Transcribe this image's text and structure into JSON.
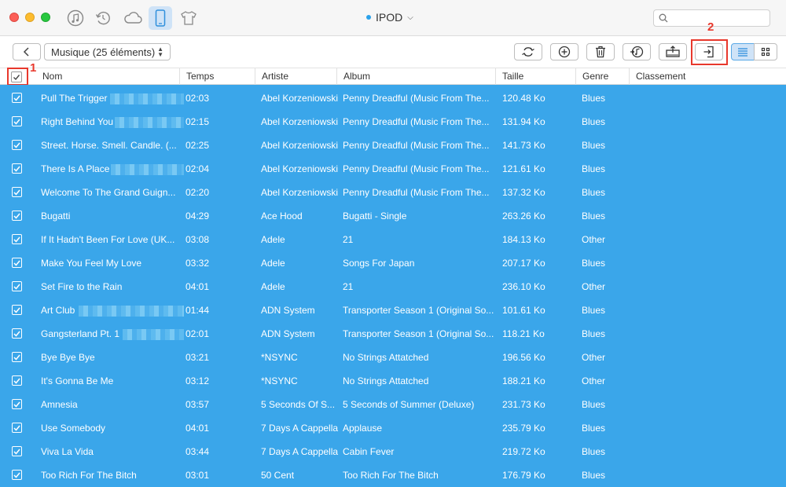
{
  "window": {
    "device_name": "IPOD",
    "search_placeholder": ""
  },
  "titlebar_icons": [
    "music-note-icon",
    "restore-icon",
    "cloud-icon",
    "device-icon",
    "tshirt-icon"
  ],
  "toolbar": {
    "category_label": "Musique (25 éléments)",
    "tools": [
      "refresh-icon",
      "add-icon",
      "trash-icon",
      "to-itunes-icon",
      "to-computer-icon",
      "to-device-icon"
    ],
    "annotation_1": "1",
    "annotation_2": "2"
  },
  "colors": {
    "selection": "#3aa6ea",
    "annotation": "#e8382c"
  },
  "columns": [
    "Nom",
    "Temps",
    "Artiste",
    "Album",
    "Taille",
    "Genre",
    "Classement"
  ],
  "rows": [
    {
      "name": "Pull The Trigger",
      "time": "02:03",
      "artist": "Abel Korzeniowski",
      "album": "Penny Dreadful (Music From The...",
      "size": "120.48 Ko",
      "genre": "Blues",
      "blurred": true
    },
    {
      "name": "Right Behind You",
      "time": "02:15",
      "artist": "Abel Korzeniowski",
      "album": "Penny Dreadful (Music From The...",
      "size": "131.94 Ko",
      "genre": "Blues",
      "blurred": true
    },
    {
      "name": "Street. Horse. Smell. Candle. (...",
      "time": "02:25",
      "artist": "Abel Korzeniowski",
      "album": "Penny Dreadful (Music From The...",
      "size": "141.73 Ko",
      "genre": "Blues",
      "blurred": false
    },
    {
      "name": "There Is A Place",
      "time": "02:04",
      "artist": "Abel Korzeniowski",
      "album": "Penny Dreadful (Music From The...",
      "size": "121.61 Ko",
      "genre": "Blues",
      "blurred": true
    },
    {
      "name": "Welcome To The Grand Guign...",
      "time": "02:20",
      "artist": "Abel Korzeniowski",
      "album": "Penny Dreadful (Music From The...",
      "size": "137.32 Ko",
      "genre": "Blues",
      "blurred": false
    },
    {
      "name": "Bugatti",
      "time": "04:29",
      "artist": "Ace Hood",
      "album": "Bugatti - Single",
      "size": "263.26 Ko",
      "genre": "Blues",
      "blurred": false
    },
    {
      "name": "If It Hadn't Been For Love (UK...",
      "time": "03:08",
      "artist": "Adele",
      "album": "21",
      "size": "184.13 Ko",
      "genre": "Other",
      "blurred": false
    },
    {
      "name": "Make You Feel My Love",
      "time": "03:32",
      "artist": "Adele",
      "album": "Songs For Japan",
      "size": "207.17 Ko",
      "genre": "Blues",
      "blurred": false
    },
    {
      "name": "Set Fire to the Rain",
      "time": "04:01",
      "artist": "Adele",
      "album": "21",
      "size": "236.10 Ko",
      "genre": "Other",
      "blurred": false
    },
    {
      "name": "Art Club",
      "time": "01:44",
      "artist": "ADN System",
      "album": "Transporter Season 1 (Original So...",
      "size": "101.61 Ko",
      "genre": "Blues",
      "blurred": true
    },
    {
      "name": "Gangsterland Pt. 1",
      "time": "02:01",
      "artist": "ADN System",
      "album": "Transporter Season 1 (Original So...",
      "size": "118.21 Ko",
      "genre": "Blues",
      "blurred": true
    },
    {
      "name": "Bye Bye Bye",
      "time": "03:21",
      "artist": "*NSYNC",
      "album": "No Strings Attatched",
      "size": "196.56 Ko",
      "genre": "Other",
      "blurred": false
    },
    {
      "name": "It's Gonna Be Me",
      "time": "03:12",
      "artist": "*NSYNC",
      "album": "No Strings Attatched",
      "size": "188.21 Ko",
      "genre": "Other",
      "blurred": false
    },
    {
      "name": "Amnesia",
      "time": "03:57",
      "artist": "5 Seconds Of S...",
      "album": "5 Seconds of Summer (Deluxe)",
      "size": "231.73 Ko",
      "genre": "Blues",
      "blurred": false
    },
    {
      "name": "Use Somebody",
      "time": "04:01",
      "artist": "7 Days A Cappella",
      "album": "Applause",
      "size": "235.79 Ko",
      "genre": "Blues",
      "blurred": false
    },
    {
      "name": "Viva La Vida",
      "time": "03:44",
      "artist": "7 Days A Cappella",
      "album": "Cabin Fever",
      "size": "219.72 Ko",
      "genre": "Blues",
      "blurred": false
    },
    {
      "name": "Too Rich For The Bitch",
      "time": "03:01",
      "artist": "50 Cent",
      "album": "Too Rich For The Bitch",
      "size": "176.79 Ko",
      "genre": "Blues",
      "blurred": false
    }
  ]
}
